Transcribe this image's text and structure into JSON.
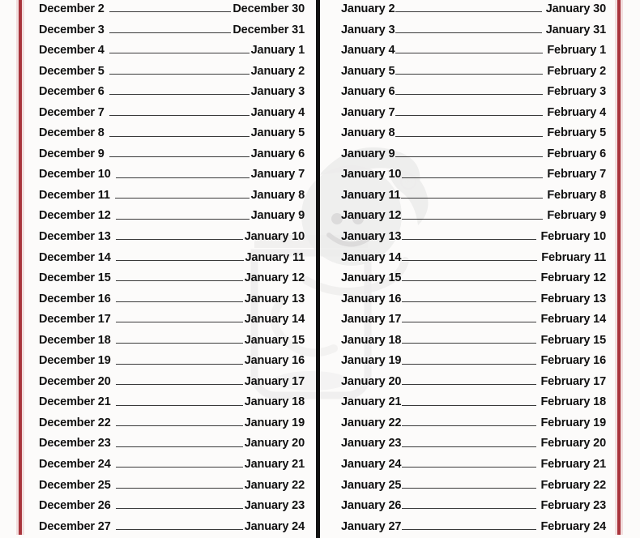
{
  "page": {
    "background_color": "#fcfbfa",
    "text_color": "#111111",
    "rule_color_red": "#a8343c",
    "rule_color_red_halo": "#f2dede",
    "divider_color_black": "#111111",
    "watermark_color": "#dddddd",
    "watermark_mark": "®"
  },
  "columns": [
    {
      "name": "left-column",
      "rows": [
        {
          "start": "December 2",
          "end": "December 30"
        },
        {
          "start": "December 3",
          "end": "December 31"
        },
        {
          "start": "December 4",
          "end": "January 1"
        },
        {
          "start": "December 5",
          "end": "January 2"
        },
        {
          "start": "December 6",
          "end": "January 3"
        },
        {
          "start": "December 7",
          "end": "January 4"
        },
        {
          "start": "December 8",
          "end": "January 5"
        },
        {
          "start": "December 9",
          "end": "January 6"
        },
        {
          "start": "December 10",
          "end": "January 7"
        },
        {
          "start": "December 11",
          "end": "January 8"
        },
        {
          "start": "December 12",
          "end": "January 9"
        },
        {
          "start": "December 13",
          "end": "January 10"
        },
        {
          "start": "December 14",
          "end": "January 11"
        },
        {
          "start": "December 15",
          "end": "January 12"
        },
        {
          "start": "December 16",
          "end": "January 13"
        },
        {
          "start": "December 17",
          "end": "January 14"
        },
        {
          "start": "December 18",
          "end": "January 15"
        },
        {
          "start": "December 19",
          "end": "January 16"
        },
        {
          "start": "December 20",
          "end": "January 17"
        },
        {
          "start": "December 21",
          "end": "January 18"
        },
        {
          "start": "December 22",
          "end": "January 19"
        },
        {
          "start": "December 23",
          "end": "January 20"
        },
        {
          "start": "December 24",
          "end": "January 21"
        },
        {
          "start": "December 25",
          "end": "January 22"
        },
        {
          "start": "December 26",
          "end": "January 23"
        },
        {
          "start": "December 27",
          "end": "January 24"
        }
      ]
    },
    {
      "name": "right-column",
      "rows": [
        {
          "start": "January 2",
          "end": "January 30"
        },
        {
          "start": "January 3",
          "end": "January 31"
        },
        {
          "start": "January 4",
          "end": "February 1"
        },
        {
          "start": "January 5",
          "end": "February 2"
        },
        {
          "start": "January 6",
          "end": "February 3"
        },
        {
          "start": "January 7",
          "end": "February 4"
        },
        {
          "start": "January 8",
          "end": "February 5"
        },
        {
          "start": "January 9",
          "end": "February 6"
        },
        {
          "start": "January 10",
          "end": "February 7"
        },
        {
          "start": "January 11",
          "end": "February 8"
        },
        {
          "start": "January 12",
          "end": "February 9"
        },
        {
          "start": "January 13",
          "end": "February 10"
        },
        {
          "start": "January 14",
          "end": "February 11"
        },
        {
          "start": "January 15",
          "end": "February 12"
        },
        {
          "start": "January 16",
          "end": "February 13"
        },
        {
          "start": "January 17",
          "end": "February 14"
        },
        {
          "start": "January 18",
          "end": "February 15"
        },
        {
          "start": "January 19",
          "end": "February 16"
        },
        {
          "start": "January 20",
          "end": "February 17"
        },
        {
          "start": "January 21",
          "end": "February 18"
        },
        {
          "start": "January 22",
          "end": "February 19"
        },
        {
          "start": "January 23",
          "end": "February 20"
        },
        {
          "start": "January 24",
          "end": "February 21"
        },
        {
          "start": "January 25",
          "end": "February 22"
        },
        {
          "start": "January 26",
          "end": "February 23"
        },
        {
          "start": "January 27",
          "end": "February 24"
        }
      ]
    }
  ]
}
